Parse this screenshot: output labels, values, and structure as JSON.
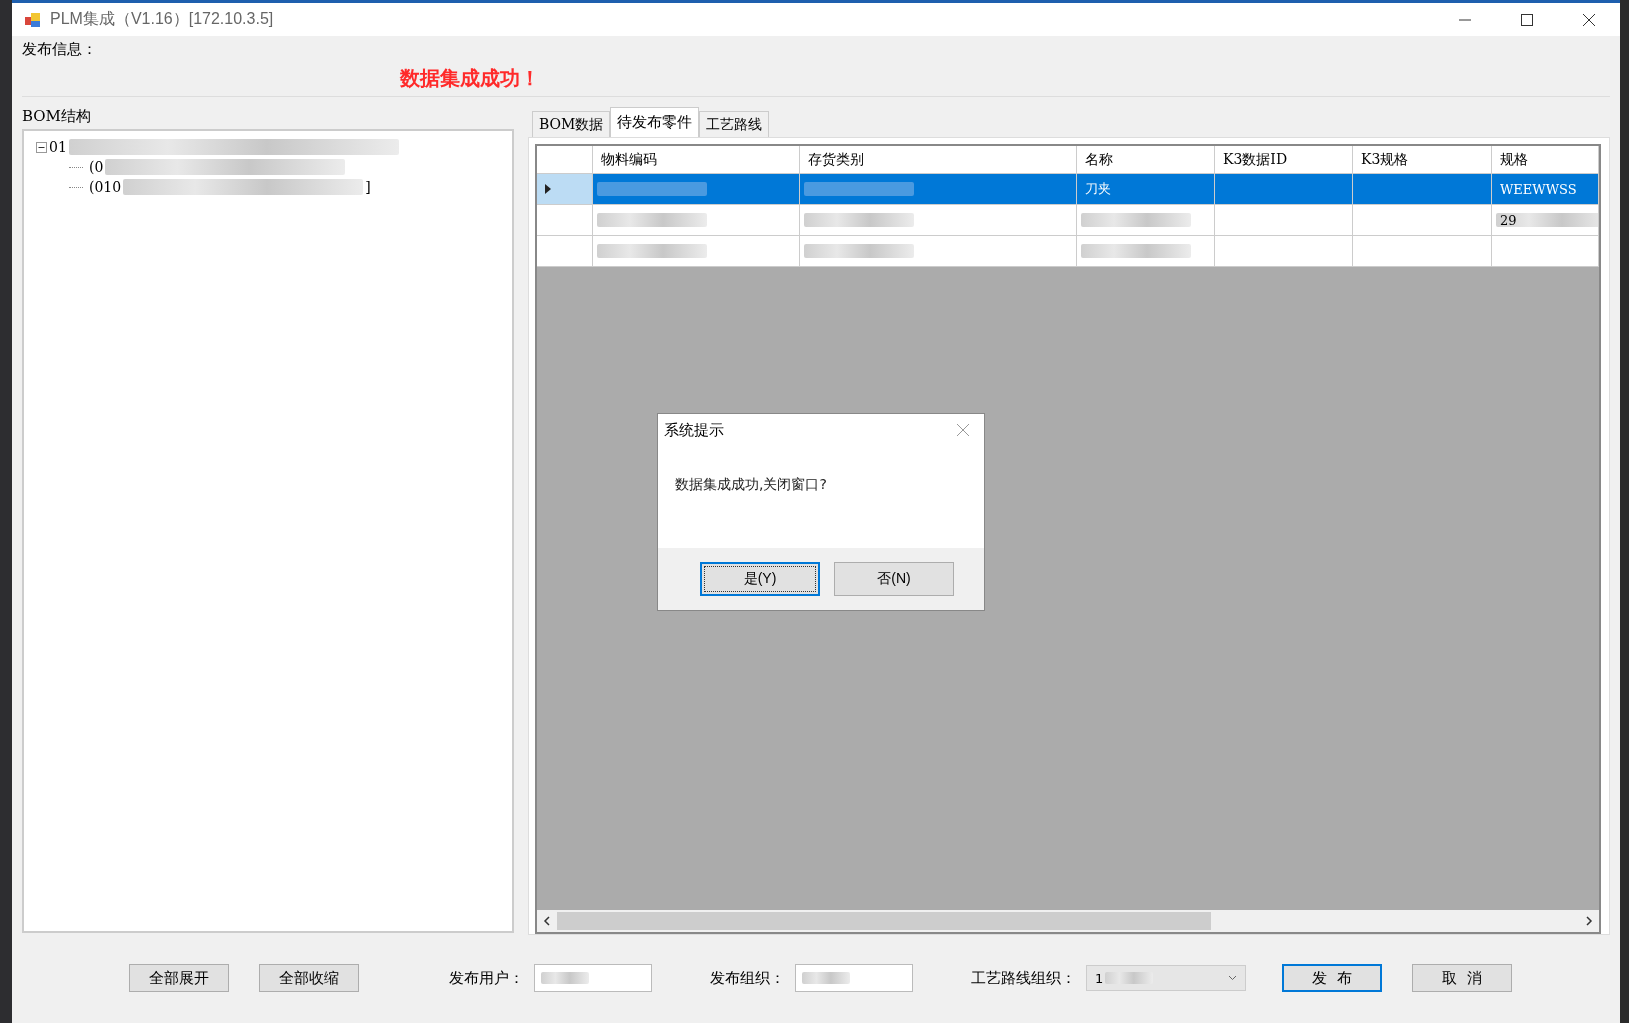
{
  "window": {
    "title": "PLM集成（V1.16）[172.10.3.5]"
  },
  "publish_info": {
    "label": "发布信息：",
    "message": "数据集成成功！"
  },
  "bom_tree": {
    "label": "BOM结构",
    "items": [
      {
        "text": "01",
        "blurred": true,
        "expanded": true,
        "children": [
          {
            "text": "(0",
            "blurred": true
          },
          {
            "text": "(010",
            "blurred": true,
            "tail": "]"
          }
        ]
      }
    ]
  },
  "tabs": [
    {
      "label": "BOM数据",
      "selected": false
    },
    {
      "label": "待发布零件",
      "selected": true
    },
    {
      "label": "工艺路线",
      "selected": false
    }
  ],
  "table": {
    "columns": [
      "物料编码",
      "存货类别",
      "名称",
      "K3数据ID",
      "K3规格",
      "规格"
    ],
    "rows": [
      {
        "selected": true,
        "cells": [
          {
            "blurred": true
          },
          {
            "blurred": true
          },
          {
            "text": "刀夹"
          },
          {},
          {},
          {
            "text": "WEEWWSS"
          }
        ]
      },
      {
        "selected": false,
        "cells": [
          {
            "blurred": true
          },
          {
            "blurred": true
          },
          {
            "blurred": true
          },
          {},
          {},
          {
            "text": "29",
            "blurred": true
          }
        ]
      },
      {
        "selected": false,
        "cells": [
          {
            "blurred": true
          },
          {
            "blurred": true
          },
          {
            "blurred": true
          },
          {},
          {},
          {}
        ]
      }
    ]
  },
  "dialog": {
    "title": "系统提示",
    "message": "数据集成成功,关闭窗口?",
    "buttons": [
      {
        "label": "是(Y)",
        "selected": true
      },
      {
        "label": "否(N)",
        "selected": false
      }
    ]
  },
  "footer": {
    "expand_all": "全部展开",
    "collapse_all": "全部收缩",
    "fields": [
      {
        "label": "发布用户：",
        "kind": "text",
        "blurred": true
      },
      {
        "label": "发布组织：",
        "kind": "text",
        "blurred": true
      },
      {
        "label": "工艺路线组织：",
        "kind": "dropdown",
        "value": "1",
        "blurred": true
      }
    ],
    "publish": "发  布",
    "cancel": "取  消"
  }
}
